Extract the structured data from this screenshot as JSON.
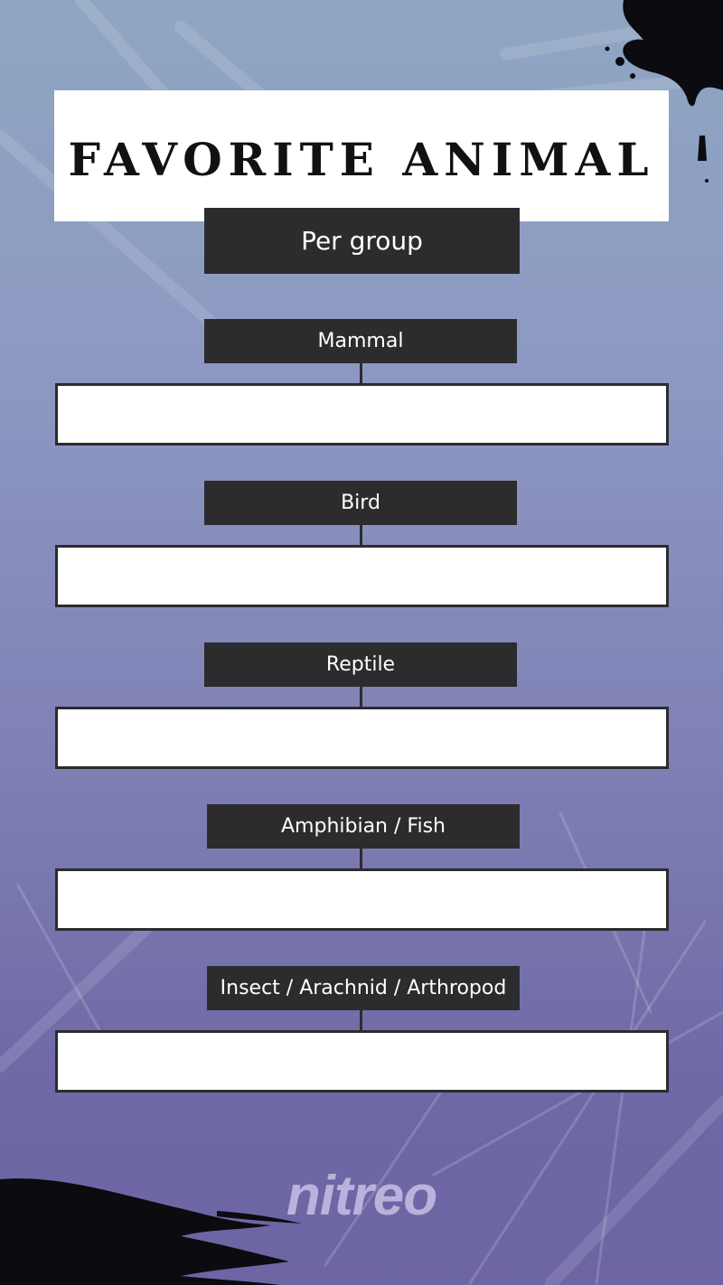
{
  "title": "FAVORITE ANIMAL",
  "subtitle": "Per group",
  "groups": [
    {
      "label": "Mammal",
      "answer": ""
    },
    {
      "label": "Bird",
      "answer": ""
    },
    {
      "label": "Reptile",
      "answer": ""
    },
    {
      "label": "Amphibian / Fish",
      "answer": ""
    },
    {
      "label": "Insect / Arachnid / Arthropod",
      "answer": ""
    }
  ],
  "logo": "nitreo",
  "colors": {
    "background": "#8f96c2",
    "label_box": "#2c2c2e",
    "answer_box": "#ffffff",
    "logo": "#b9b3dc"
  }
}
